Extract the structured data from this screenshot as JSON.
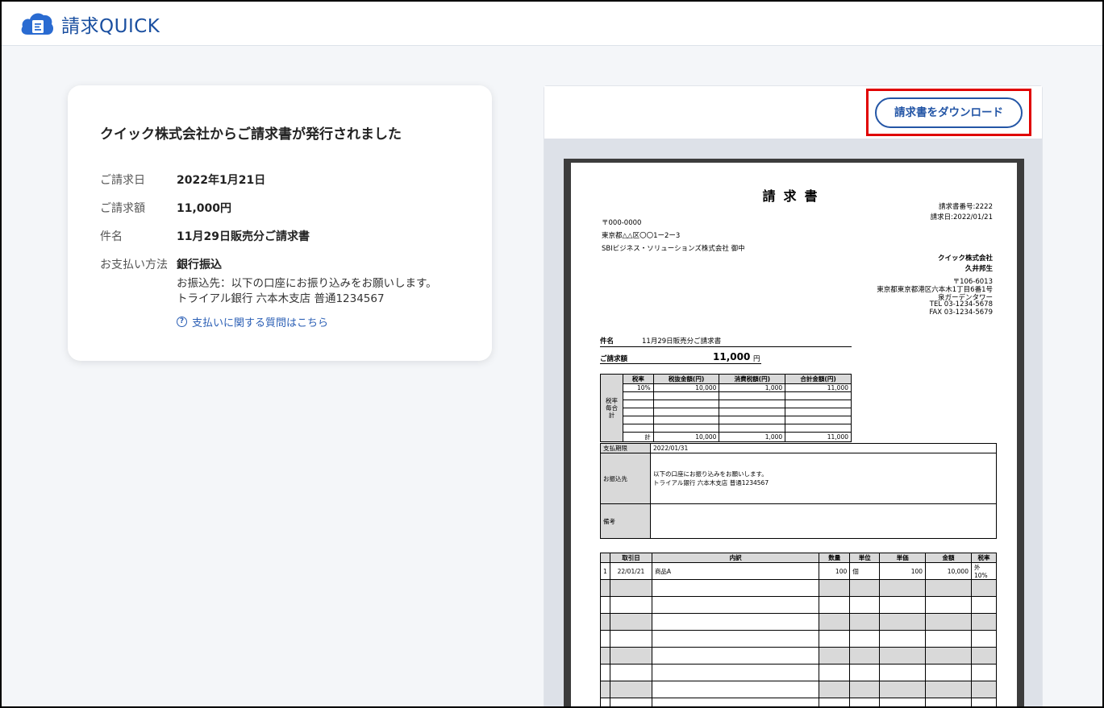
{
  "app": {
    "logo_kanji": "請求",
    "logo_latin": "QUICK"
  },
  "info": {
    "title": "クイック株式会社からご請求書が発行されました",
    "rows": [
      {
        "label": "ご請求日",
        "value": "2022年1月21日"
      },
      {
        "label": "ご請求額",
        "value": "11,000円"
      },
      {
        "label": "件名",
        "value": "11月29日販売分ご請求書"
      },
      {
        "label": "お支払い方法",
        "value": "銀行振込"
      }
    ],
    "transfer_line1": "お振込先：以下の口座にお振り込みをお願いします。",
    "transfer_line2": "トライアル銀行 六本木支店 普通1234567",
    "help_icon": "?",
    "help_link": "支払いに関する質問はこちら"
  },
  "preview": {
    "download_label": "請求書をダウンロード"
  },
  "invoice": {
    "title": "請求書",
    "number": "請求書番号:2222",
    "date": "請求日:2022/01/21",
    "postal": "〒000-0000",
    "address": "東京都△△区〇〇1ー2ー3",
    "recipient": "SBIビジネス・ソリューションズ株式会社 御中",
    "issuer_company": "クイック株式会社",
    "issuer_person": "久井邦生",
    "issuer_postal": "〒106-6013",
    "issuer_address": "東京都東京都港区六本木1丁目6番1号",
    "issuer_building": "泉ガーデンタワー",
    "issuer_tel": "TEL 03-1234-5678",
    "issuer_fax": "FAX 03-1234-5679",
    "subject_label": "件名",
    "subject_value": "11月29日販売分ご請求書",
    "amount_label": "ご請求額",
    "amount_value": "11,000",
    "amount_unit": "円",
    "tax_table": {
      "side_label": "税率毎合計",
      "headers": [
        "税率",
        "税抜金額(円)",
        "消費税額(円)",
        "合計金額(円)"
      ],
      "row": [
        "10%",
        "10,000",
        "1,000",
        "11,000"
      ],
      "total_label": "計",
      "total": [
        "10,000",
        "1,000",
        "11,000"
      ]
    },
    "payment": {
      "due_label": "支払期限",
      "due_value": "2022/01/31",
      "bank_label": "お振込先",
      "bank_line1": "以下の口座にお振り込みをお願いします。",
      "bank_line2": "トライアル銀行 六本木支店 普通1234567",
      "memo_label": "備考"
    },
    "items": {
      "headers": [
        "",
        "取引日",
        "内訳",
        "数量",
        "単位",
        "単価",
        "金額",
        "税率"
      ],
      "rows": [
        [
          "1",
          "22/01/21",
          "商品A",
          "100",
          "個",
          "100",
          "10,000",
          "外10%"
        ]
      ]
    }
  }
}
